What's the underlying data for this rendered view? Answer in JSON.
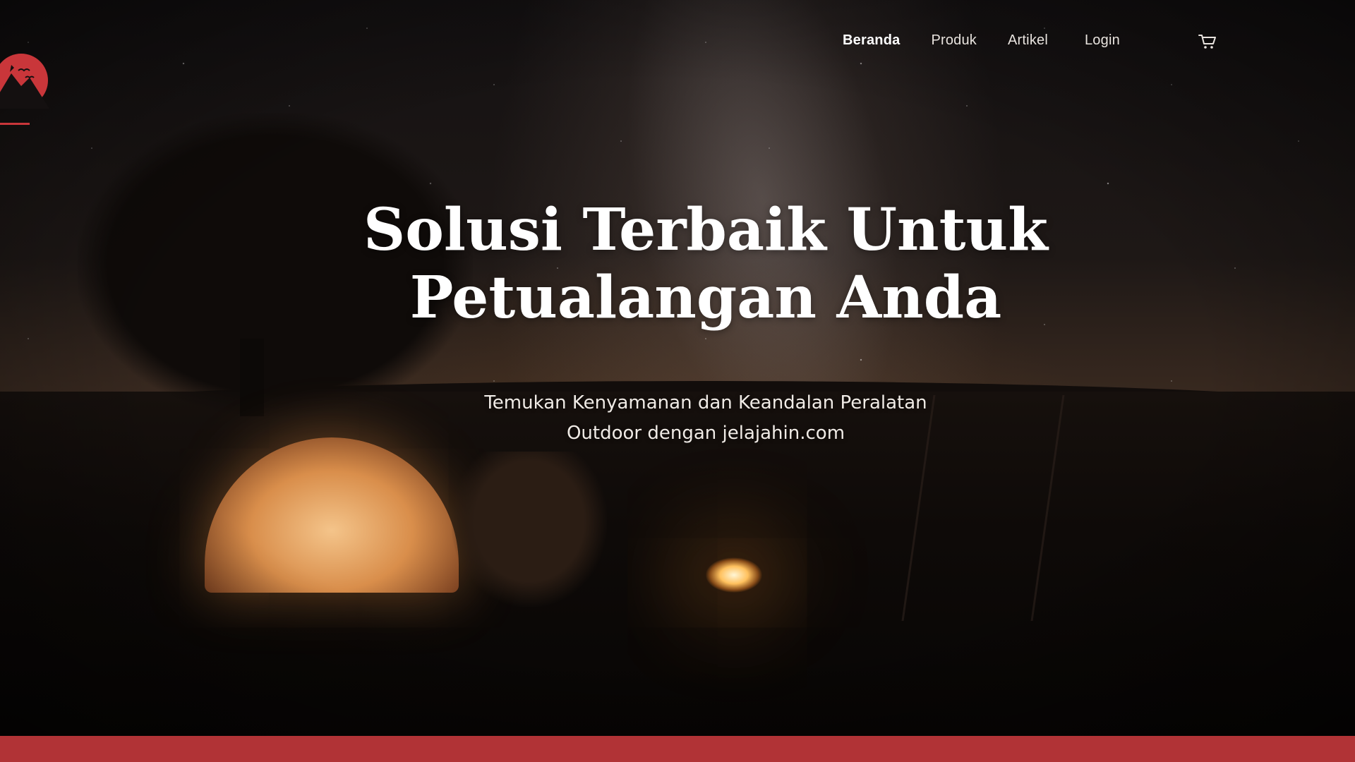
{
  "nav": {
    "items": [
      {
        "label": "Beranda",
        "active": true
      },
      {
        "label": "Produk",
        "active": false
      },
      {
        "label": "Artikel",
        "active": false
      }
    ],
    "login_label": "Login",
    "cart_icon": "cart-icon"
  },
  "hero": {
    "headline_line1": "Solusi Terbaik Untuk",
    "headline_line2": "Petualangan Anda",
    "subtitle_line1": "Temukan Kenyamanan dan Keandalan Peralatan",
    "subtitle_line2": "Outdoor dengan jelajahin.com"
  },
  "colors": {
    "brand_red": "#b13336",
    "nav_text": "#e9e4df",
    "headline": "#ffffff"
  }
}
